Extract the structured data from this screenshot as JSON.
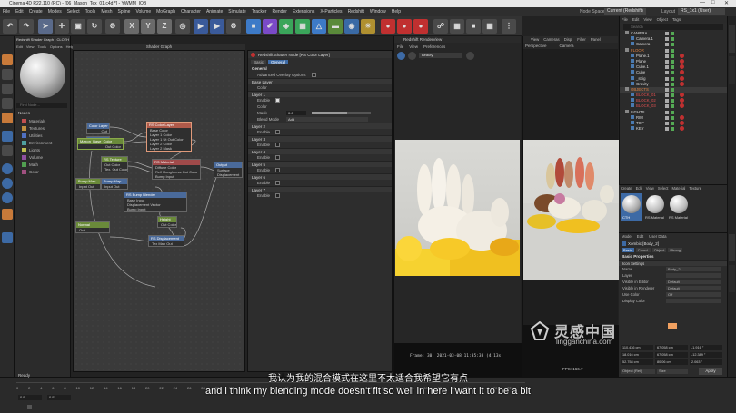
{
  "window": {
    "title": "Cinema 4D R22.110 (RC) - [06_Mason_Tex_01.c4d *] - YWMM_IOB",
    "node_space_label": "Node Space",
    "node_space_value": "Current (Redshift)",
    "layout_label": "Layout",
    "layout_value": "RS_1x1 (User)"
  },
  "menu": [
    "File",
    "Edit",
    "Create",
    "Modes",
    "Select",
    "Tools",
    "Mesh",
    "Spline",
    "Volume",
    "MoGraph",
    "Character",
    "Animate",
    "Simulate",
    "Tracker",
    "Render",
    "Extensions",
    "X-Particles",
    "Redshift",
    "Window",
    "Help"
  ],
  "toolbar": {
    "axis_buttons": [
      "X",
      "Y",
      "Z"
    ]
  },
  "material_panel": {
    "header": "Redshift Shader Graph - CLOTH",
    "menu": [
      "Edit",
      "View",
      "Tools",
      "Options",
      "Help"
    ],
    "find_placeholder": "Find Node...",
    "nodes_label": "Nodes",
    "categories": [
      {
        "label": "Materials",
        "color": "#c05050"
      },
      {
        "label": "Textures",
        "color": "#c09040"
      },
      {
        "label": "Utilities",
        "color": "#5070c0"
      },
      {
        "label": "Environment",
        "color": "#50a0a0"
      },
      {
        "label": "Lights",
        "color": "#c0c050"
      },
      {
        "label": "Volume",
        "color": "#9050a0"
      },
      {
        "label": "Math",
        "color": "#50a050"
      },
      {
        "label": "Color",
        "color": "#a05080"
      }
    ]
  },
  "graph": {
    "title": "Shader Graph",
    "nodes": {
      "color_layer_1": {
        "title": "Color Layer",
        "ports": [
          "Out"
        ]
      },
      "color_layer_2": {
        "title": "Color Layer",
        "ports": [
          "Out"
        ]
      },
      "tex_base_color": {
        "title": "Maxon_Base_Color",
        "ports": [
          "Out Color"
        ]
      },
      "rs_color_layer": {
        "title": "RS Color Layer",
        "ports": [
          "Base Color",
          "Layer 1 Color",
          "Layer 1 Ut Out Color",
          "Layer 2 Color",
          "Layer 2 Mask"
        ]
      },
      "rs_texture": {
        "title": "RS Texture",
        "ports": [
          "Out Color",
          "Tex. Out Color"
        ]
      },
      "rs_material": {
        "title": "RS Material",
        "ports": [
          "Diffuse Color",
          "Refl Roughness Out Color",
          "Bump Input"
        ]
      },
      "output": {
        "title": "Output",
        "ports": [
          "Surface",
          "Displacement"
        ]
      },
      "bump_map": {
        "title": "Bump Map",
        "ports": [
          "Input Out"
        ]
      },
      "bump_map_2": {
        "title": "Bump Map",
        "ports": [
          "Input Out"
        ]
      },
      "rs_bump_blender": {
        "title": "RS Bump Blender",
        "ports": [
          "Base Input",
          "Displacement Vector",
          "Bump Input"
        ]
      },
      "normal_tex": {
        "title": "Normal",
        "ports": [
          "Out"
        ]
      },
      "rs_displacement": {
        "title": "RS Displacement",
        "ports": [
          "Tex Map Out"
        ]
      },
      "tex_height": {
        "title": "Height",
        "ports": [
          "Out Color"
        ]
      }
    }
  },
  "attributes": {
    "node_title": "Redshift Shader Node [RS Color Layer]",
    "tabs": [
      "Basic",
      "General"
    ],
    "section_general": "General",
    "advanced_overlay": "Advanced Overlay Options",
    "base_layer": "Base Layer",
    "base_color_label": "Color",
    "layers": [
      {
        "name": "Layer 1",
        "enable": "Enable",
        "color": "Color",
        "mask": "Mask",
        "mask_value": "0.6",
        "blend": "Blend Mode",
        "blend_value": "Add"
      },
      {
        "name": "Layer 2",
        "enable": "Enable"
      },
      {
        "name": "Layer 3",
        "enable": "Enable"
      },
      {
        "name": "Layer 4",
        "enable": "Enable"
      },
      {
        "name": "Layer 5",
        "enable": "Enable"
      },
      {
        "name": "Layer 6",
        "enable": "Enable"
      },
      {
        "name": "Layer 7",
        "enable": "Enable"
      }
    ]
  },
  "render_view": {
    "title": "Redshift RenderView",
    "menu": [
      "File",
      "View",
      "Preferences"
    ],
    "aov": "Beauty",
    "status": "Frame: 30, 2021-03-08 11:35:38 (4.13s)"
  },
  "viewport": {
    "menu": [
      "View",
      "Cameras",
      "Displ",
      "Filter",
      "Panel"
    ],
    "label": "Perspective",
    "camera": "Camera",
    "fps": "FPS: 166.7"
  },
  "object_manager": {
    "menu": [
      "File",
      "Edit",
      "View",
      "Object",
      "Tags"
    ],
    "search": "Search",
    "objects": [
      {
        "name": "CAMERA",
        "indent": 0,
        "color": "#ddd"
      },
      {
        "name": "Camera.1",
        "indent": 1,
        "color": "#ddd"
      },
      {
        "name": "Camera",
        "indent": 1,
        "color": "#ddd"
      },
      {
        "name": "FLOOR",
        "indent": 0,
        "color": "#e08040"
      },
      {
        "name": "Plane.1",
        "indent": 1,
        "color": "#ddd"
      },
      {
        "name": "Plane",
        "indent": 1,
        "color": "#ddd"
      },
      {
        "name": "Cube.1",
        "indent": 1,
        "color": "#ddd"
      },
      {
        "name": "Cube",
        "indent": 1,
        "color": "#ddd"
      },
      {
        "name": "_strig",
        "indent": 1,
        "color": "#ddd"
      },
      {
        "name": "Gravity",
        "indent": 1,
        "color": "#ddd"
      },
      {
        "name": "OBJECTS",
        "indent": 0,
        "color": "#e08040"
      },
      {
        "name": "BLOCK_01",
        "indent": 1,
        "color": "#e05050"
      },
      {
        "name": "BLOCK_02",
        "indent": 1,
        "color": "#e05050"
      },
      {
        "name": "BLOCK_03",
        "indent": 1,
        "color": "#e05050"
      },
      {
        "name": "LIGHTS",
        "indent": 0,
        "color": "#ddd"
      },
      {
        "name": "RIM",
        "indent": 1,
        "color": "#ddd"
      },
      {
        "name": "TOP",
        "indent": 1,
        "color": "#ddd"
      },
      {
        "name": "KEY",
        "indent": 1,
        "color": "#ddd"
      }
    ]
  },
  "material_manager": {
    "menu": [
      "Create",
      "Edit",
      "View",
      "Select",
      "Material",
      "Texture"
    ],
    "materials": [
      "CTH",
      "RS Material",
      "RS Material"
    ]
  },
  "attr_manager": {
    "menu": [
      "Mode",
      "Edit",
      "User Data"
    ],
    "object_name_label": "Xombic [Body_2]",
    "tabs": [
      "Basic",
      "Coord.",
      "Object",
      "Phong"
    ],
    "section": "Basic Properties",
    "icon_settings": "Icon Settings",
    "props": [
      {
        "label": "Name",
        "value": "Body_2"
      },
      {
        "label": "Layer",
        "value": ""
      },
      {
        "label": "Visible in Editor",
        "value": "Default"
      },
      {
        "label": "Visible in Renderer",
        "value": "Default"
      },
      {
        "label": "Use Color",
        "value": "Off"
      },
      {
        "label": "Display Color",
        "value": ""
      }
    ],
    "coords": [
      {
        "p": "110.436 cm",
        "s": "67.058 cm",
        "r": "-1.916 °"
      },
      {
        "p": "18.016 cm",
        "s": "67.058 cm",
        "r": "-12.389 °"
      },
      {
        "p": "52.758 cm",
        "s": "80.06 cm",
        "r": "2.063 °"
      }
    ],
    "apply": "Apply",
    "mode": "Object (Rel)",
    "size": "Size"
  },
  "timeline": {
    "status": "Ready",
    "ticks": [
      "0",
      "2",
      "4",
      "6",
      "8",
      "10",
      "12",
      "14",
      "16",
      "18",
      "20",
      "22",
      "24",
      "26",
      "28",
      "30",
      "32",
      "34",
      "36",
      "38",
      "40",
      "42",
      "44",
      "46",
      "48",
      "50",
      "52",
      "54",
      "56",
      "58",
      "60",
      "62",
      "64",
      "66",
      "68",
      "70",
      "72",
      "74"
    ],
    "current_frame": "0 F",
    "field_value": "0 F"
  },
  "subtitles": {
    "chinese": "我认为我的混合模式在这里不太适合我希望它有点",
    "english": "and i think my blending mode doesn't fit so well in here i want it to be a bit"
  },
  "watermark": {
    "cn": "灵感中国",
    "url": "lingganchina.com"
  }
}
